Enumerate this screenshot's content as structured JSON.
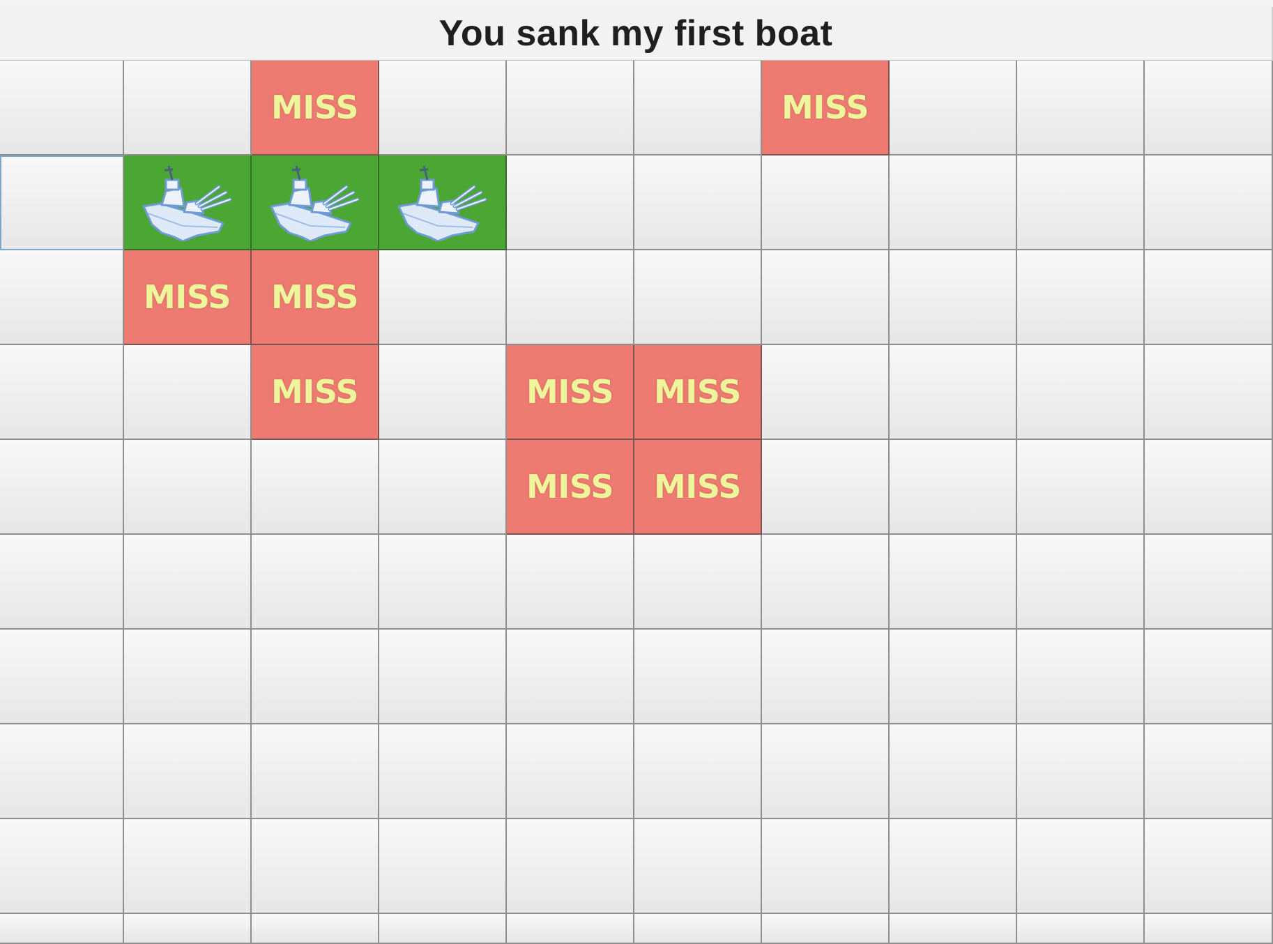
{
  "status": {
    "message": "You sank my first boat"
  },
  "board": {
    "rows": 10,
    "cols": 10,
    "miss_label": "MISS",
    "colors": {
      "miss": "#ee7b72",
      "hit": "#4ca634",
      "empty": "#efefef",
      "miss_text": "#eef59b"
    },
    "hit_icon": "battleship-icon",
    "focused_cell": "r1c0",
    "cells": [
      [
        "",
        "",
        "miss",
        "",
        "",
        "",
        "miss",
        "",
        "",
        ""
      ],
      [
        "",
        "hit",
        "hit",
        "hit",
        "",
        "",
        "",
        "",
        "",
        ""
      ],
      [
        "",
        "miss",
        "miss",
        "",
        "",
        "",
        "",
        "",
        "",
        ""
      ],
      [
        "",
        "",
        "miss",
        "",
        "miss",
        "miss",
        "",
        "",
        "",
        ""
      ],
      [
        "",
        "",
        "",
        "",
        "miss",
        "miss",
        "",
        "",
        "",
        ""
      ],
      [
        "",
        "",
        "",
        "",
        "",
        "",
        "",
        "",
        "",
        ""
      ],
      [
        "",
        "",
        "",
        "",
        "",
        "",
        "",
        "",
        "",
        ""
      ],
      [
        "",
        "",
        "",
        "",
        "",
        "",
        "",
        "",
        "",
        ""
      ],
      [
        "",
        "",
        "",
        "",
        "",
        "",
        "",
        "",
        "",
        ""
      ],
      [
        "",
        "",
        "",
        "",
        "",
        "",
        "",
        "",
        "",
        ""
      ]
    ]
  }
}
